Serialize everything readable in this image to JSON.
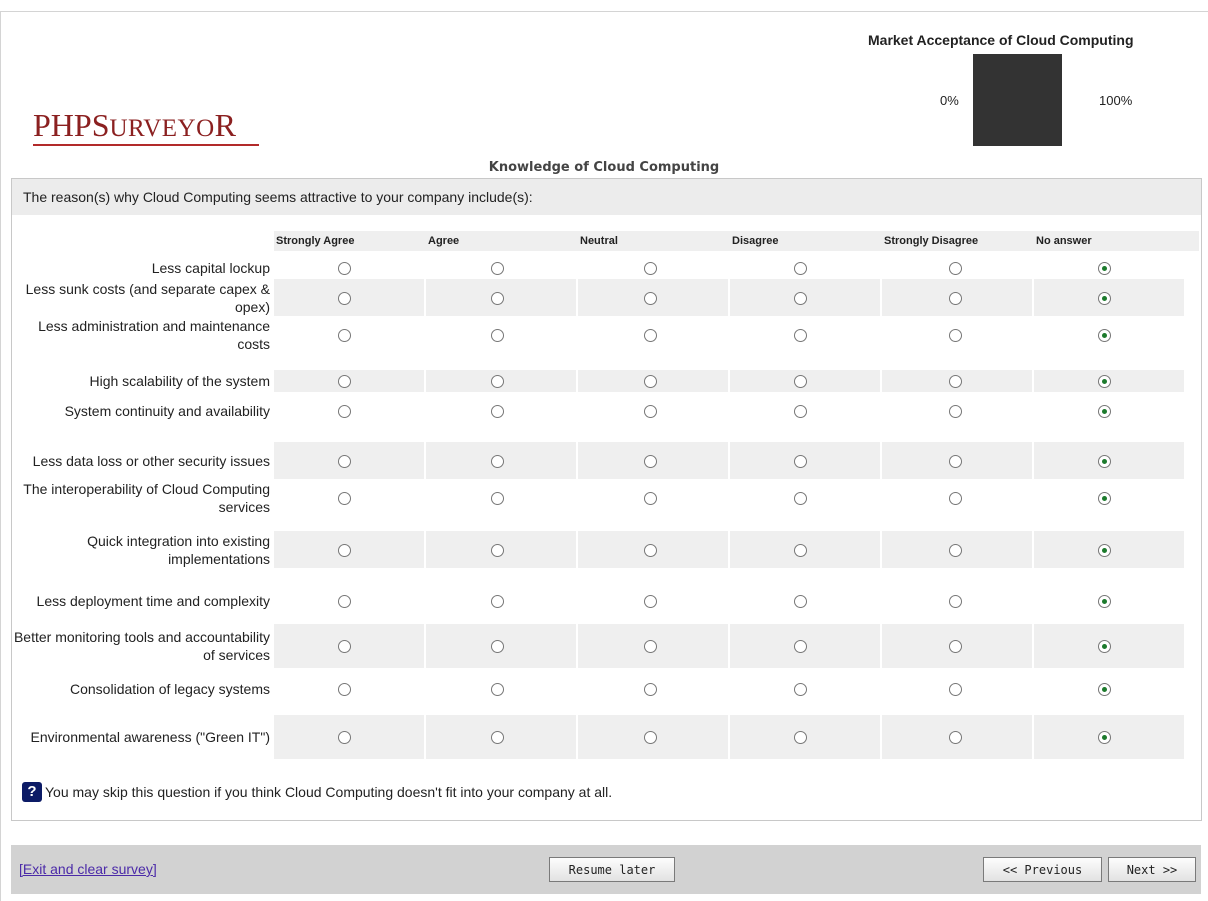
{
  "logo": {
    "first": "PHP",
    "big_s": "S",
    "rest_1": "URVEYO",
    "big_r": "R"
  },
  "progress": {
    "title": "Market Acceptance of Cloud Computing",
    "min_label": "0%",
    "max_label": "100%",
    "value_fraction": 1.0
  },
  "group_title": "Knowledge of Cloud Computing",
  "question": {
    "text": "The reason(s) why Cloud Computing seems attractive to your company include(s):",
    "columns": [
      "Strongly Agree",
      "Agree",
      "Neutral",
      "Disagree",
      "Strongly Disagree",
      "No answer"
    ],
    "rows": [
      {
        "label": "Less capital lockup",
        "selected": "No answer"
      },
      {
        "label": "Less sunk costs (and separate capex & opex)",
        "selected": "No answer"
      },
      {
        "label": "Less administration and maintenance costs",
        "selected": "No answer"
      },
      {
        "label": "High scalability of the system",
        "selected": "No answer"
      },
      {
        "label": "System continuity and availability",
        "selected": "No answer"
      },
      {
        "label": "Less data loss or other security issues",
        "selected": "No answer"
      },
      {
        "label": "The interoperability of Cloud Computing services",
        "selected": "No answer"
      },
      {
        "label": "Quick integration into existing implementations",
        "selected": "No answer"
      },
      {
        "label": "Less deployment time and complexity",
        "selected": "No answer"
      },
      {
        "label": "Better monitoring tools and accountability of services",
        "selected": "No answer"
      },
      {
        "label": "Consolidation of legacy systems",
        "selected": "No answer"
      },
      {
        "label": "Environmental awareness (\"Green IT\")",
        "selected": "No answer"
      }
    ],
    "help_icon": "question-mark-icon",
    "help_text": "You may skip this question if you think Cloud Computing doesn't fit into your company at all."
  },
  "nav": {
    "exit_label": "[Exit and clear survey]",
    "resume_label": "Resume later",
    "previous_label": "<< Previous",
    "next_label": "Next >>"
  },
  "colors": {
    "selected_radio": "#1c7a2c",
    "progress_fill": "#333333",
    "logo": "#8b2020",
    "help_icon_bg": "#0c1b66"
  }
}
